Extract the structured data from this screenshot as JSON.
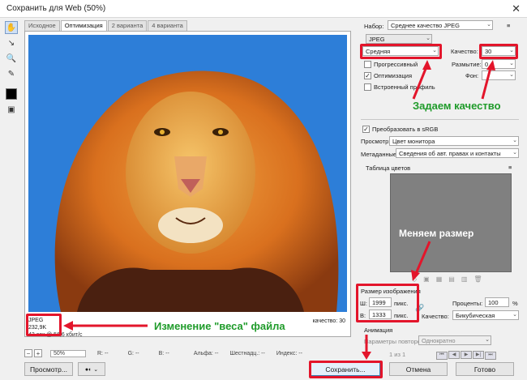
{
  "window": {
    "title": "Сохранить для Web (50%)",
    "close": "✕"
  },
  "tabs": [
    "Исходное",
    "Оптимизация",
    "2 варианта",
    "4 варианта"
  ],
  "image_info": {
    "format": "JPEG",
    "size": "232,9K",
    "speed": "43 сек @ 56,6 кбит/с"
  },
  "canvas": {
    "quality_label": "качество: 30"
  },
  "status": {
    "zoom": "50%",
    "r": "R: --",
    "g": "G: --",
    "b": "B: --",
    "alpha": "Альфа: --",
    "hex": "Шестнадц.: --",
    "index": "Индекс: --"
  },
  "settings": {
    "preset_label": "Набор:",
    "preset_value": "Среднее качество JPEG",
    "format": "JPEG",
    "compression": "Средняя",
    "quality_label": "Качество:",
    "quality_value": "30",
    "progressive": "Прогрессивный",
    "blur_label": "Размытие:",
    "blur_value": "0",
    "optimized": "Оптимизация",
    "matte_label": "Фон:",
    "embed_profile": "Встроенный профиль",
    "convert_srgb": "Преобразовать в sRGB",
    "preview_label": "Просмотр:",
    "preview_value": "Цвет монитора",
    "metadata_label": "Метаданные:",
    "metadata_value": "Сведения об авт. правах и контакты"
  },
  "color_table": {
    "title": "Таблица цветов"
  },
  "image_size": {
    "title": "Размер изображения",
    "w_label": "Ш:",
    "w_value": "1999",
    "h_label": "В:",
    "h_value": "1333",
    "unit": "пикс.",
    "percent_label": "Проценты:",
    "percent_value": "100",
    "percent_unit": "%",
    "quality_label": "Качество:",
    "quality_value": "Бикубическая"
  },
  "animation": {
    "title": "Анимация",
    "loop_label": "Параметры повторов:",
    "loop_value": "Однократно",
    "frame": "1 из 1"
  },
  "buttons": {
    "preview": "Просмотр...",
    "save": "Сохранить...",
    "cancel": "Отмена",
    "done": "Готово"
  },
  "annotations": {
    "quality": "Задаем качество",
    "size": "Меняем размер",
    "weight": "Изменение \"веса\" файла"
  },
  "colors": {
    "annotation_red": "#e3152b",
    "annotation_green": "#1f9b2a",
    "sky": "#2e7fd9",
    "mane": "#e8862a"
  }
}
